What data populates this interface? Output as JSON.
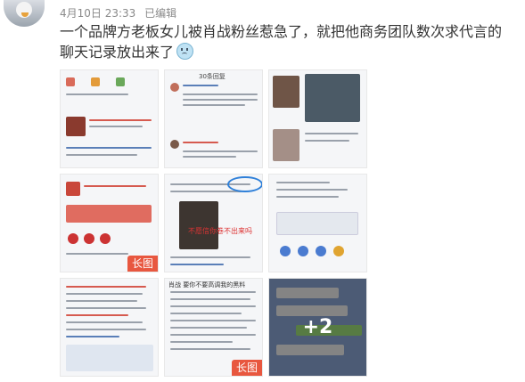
{
  "post": {
    "date": "4月10日 23:33",
    "edited": "已编辑",
    "text": "一个品牌方老板女儿被肖战粉丝惹急了，就把他商务团队数次求代言的聊天记录放出来了"
  },
  "tiles": [
    {
      "badge": ""
    },
    {
      "badge": "",
      "title": "30条回复"
    },
    {
      "badge": ""
    },
    {
      "badge": "长图"
    },
    {
      "badge": "",
      "caption": "不愿信你卷不出来吗"
    },
    {
      "badge": ""
    },
    {
      "badge": ""
    },
    {
      "badge": "长图",
      "title": "肖战 要你不要高调我的黑料"
    },
    {
      "badge": "",
      "overlay": "+2"
    }
  ],
  "colors": {
    "badge": "#e8573f",
    "meta": "#8a8a8a",
    "text": "#333333"
  }
}
